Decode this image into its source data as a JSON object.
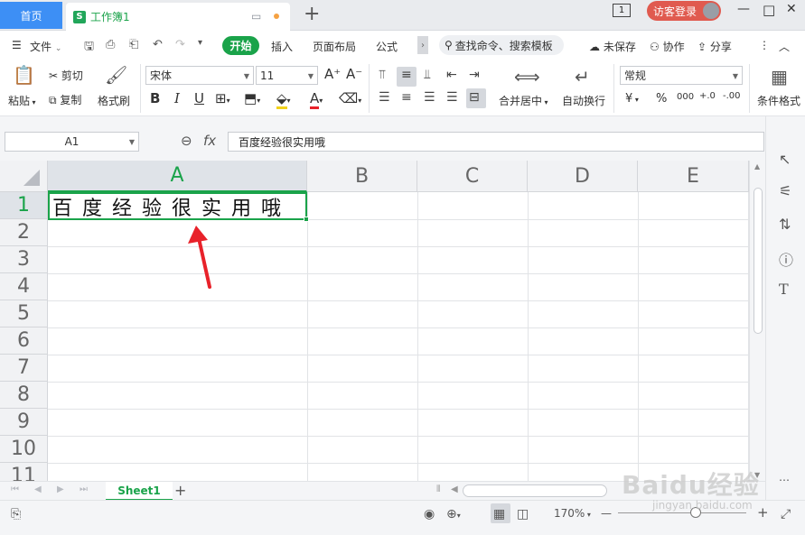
{
  "titlebar": {
    "home_tab": "首页",
    "doc_logo": "S",
    "doc_tab": "工作簿1",
    "new_tab": "+",
    "window_badge": "1",
    "guest_login": "访客登录",
    "minimize": "—",
    "maximize": "□",
    "close": "✕"
  },
  "menubar": {
    "file": "文件",
    "start": "开始",
    "insert": "插入",
    "page_layout": "页面布局",
    "formula": "公式",
    "search_placeholder": "查找命令、搜索模板",
    "unsaved": "未保存",
    "collaborate": "协作",
    "share": "分享",
    "more": "⋮",
    "collapse": "︿"
  },
  "ribbon": {
    "paste": "粘贴",
    "cut": "剪切",
    "copy": "复制",
    "format_painter": "格式刷",
    "font_name": "宋体",
    "font_size": "11",
    "bold": "B",
    "italic": "I",
    "underline": "U",
    "merge_center": "合并居中",
    "wrap_text": "自动换行",
    "number_format": "常规",
    "currency": "¥",
    "percent": "%",
    "thousands": "000",
    "inc_decimal": "+.0",
    "dec_decimal": "-.00",
    "conditional_format": "条件格式"
  },
  "formulabar": {
    "name_box": "A1",
    "fx": "fx",
    "formula": "百度经验很实用哦"
  },
  "grid": {
    "columns": [
      "A",
      "B",
      "C",
      "D",
      "E"
    ],
    "rows": [
      "1",
      "2",
      "3",
      "4",
      "5",
      "6",
      "7",
      "8",
      "9",
      "10",
      "11"
    ],
    "selected_cell": "A1",
    "cell_A1": "百度经验很实用哦"
  },
  "sheets": {
    "active": "Sheet1",
    "add": "+"
  },
  "statusbar": {
    "zoom": "170%",
    "zoom_out": "—",
    "zoom_in": "+",
    "expand": "⤢"
  },
  "watermark": {
    "brand": "Baidu经验",
    "url": "jingyan.baidu.com"
  },
  "colors": {
    "accent_green": "#1aa34a",
    "home_tab_blue": "#3d8ff5",
    "guest_red": "#e05a4f",
    "arrow_red": "#e8222a"
  }
}
